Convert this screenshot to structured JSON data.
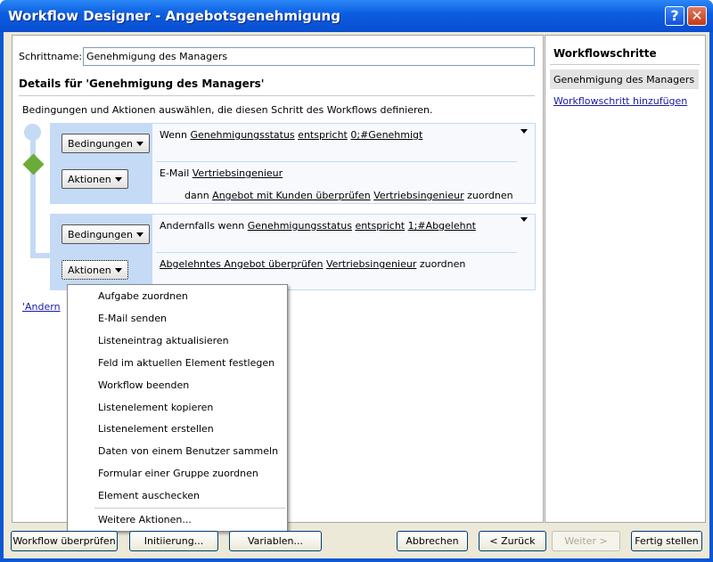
{
  "window": {
    "title": "Workflow Designer - Angebotsgenehmigung",
    "help": "?",
    "close": "✕"
  },
  "step": {
    "name_label": "Schrittname:",
    "name_value": "Genehmigung des Managers",
    "details_heading": "Details für 'Genehmigung des Managers'",
    "instructions": "Bedingungen und Aktionen auswählen, die diesen Schritt des Workflows definieren."
  },
  "buttons": {
    "conditions": "Bedingungen",
    "actions": "Aktionen"
  },
  "block1": {
    "cond": {
      "wenn": "Wenn",
      "field": "Genehmigungsstatus",
      "op": "entspricht",
      "value": "0;#Genehmigt"
    },
    "act1": {
      "prefix": "E-Mail",
      "target": "Vertriebsingenieur"
    },
    "act2": {
      "prefix": "dann",
      "task": "Angebot mit Kunden überprüfen",
      "target": "Vertriebsingenieur",
      "suffix": "zuordnen"
    }
  },
  "block2": {
    "cond": {
      "wenn": "Andernfalls wenn",
      "field": "Genehmigungsstatus",
      "op": "entspricht",
      "value": "1;#Abgelehnt"
    },
    "act1": {
      "task": "Abgelehntes Angebot überprüfen",
      "target": "Vertriebsingenieur",
      "suffix": "zuordnen"
    }
  },
  "add_else_link": "'Andern",
  "menu": {
    "items": [
      "Aufgabe zuordnen",
      "E-Mail senden",
      "Listeneintrag aktualisieren",
      "Feld im aktuellen Element festlegen",
      "Workflow beenden",
      "Listenelement kopieren",
      "Listenelement erstellen",
      "Daten von einem Benutzer sammeln",
      "Formular einer Gruppe zuordnen",
      "Element auschecken"
    ],
    "more": "Weitere Aktionen..."
  },
  "sidebar": {
    "title": "Workflowschritte",
    "selected": "Genehmigung des Managers",
    "add_link": "Workflowschritt hinzufügen"
  },
  "footer": {
    "check": "Workflow überprüfen",
    "init": "Initiierung...",
    "vars": "Variablen...",
    "cancel": "Abbrechen",
    "back": "< Zurück",
    "next": "Weiter >",
    "finish": "Fertig stellen"
  },
  "colors": {
    "titlebar": "#0b5ce0",
    "accent_green": "#6bab3a",
    "block_blue": "#c5daf5"
  }
}
